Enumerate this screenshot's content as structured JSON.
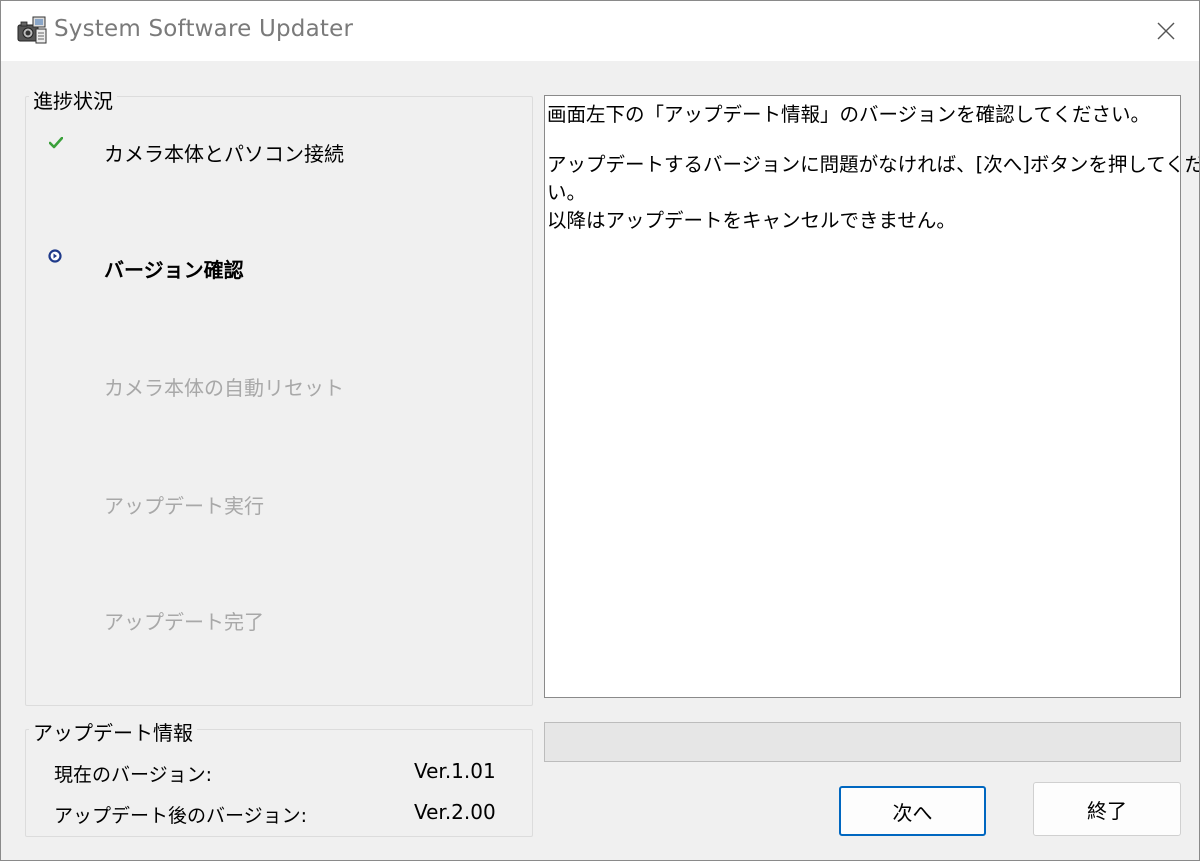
{
  "window": {
    "title": "System Software Updater"
  },
  "progress": {
    "legend": "進捗状況",
    "steps": [
      {
        "label": "カメラ本体とパソコン接続",
        "state": "done"
      },
      {
        "label": "バージョン確認",
        "state": "current"
      },
      {
        "label": "カメラ本体の自動リセット",
        "state": "pending"
      },
      {
        "label": "アップデート実行",
        "state": "pending"
      },
      {
        "label": "アップデート完了",
        "state": "pending"
      }
    ]
  },
  "update_info": {
    "legend": "アップデート情報",
    "current_label": "現在のバージョン:",
    "current_value": "Ver.1.01",
    "after_label": "アップデート後のバージョン:",
    "after_value": "Ver.2.00"
  },
  "message": {
    "lines": [
      "画面左下の「アップデート情報」のバージョンを確認してください。",
      "",
      "アップデートするバージョンに問題がなければ、[次へ]ボタンを押してくださ",
      "い。",
      "以降はアップデートをキャンセルできません。"
    ]
  },
  "progress_bar": {
    "value": 0
  },
  "buttons": {
    "next_label": "次へ",
    "exit_label": "終了"
  },
  "icons": {
    "app": "updater-app-icon",
    "close": "close-icon",
    "done": "checkmark-icon",
    "current": "current-step-arrow-icon"
  },
  "colors": {
    "check_green": "#3aa03a",
    "current_blue": "#1f3a8a",
    "pending_text": "#a8a8a8",
    "default_button_border": "#0067c0"
  }
}
